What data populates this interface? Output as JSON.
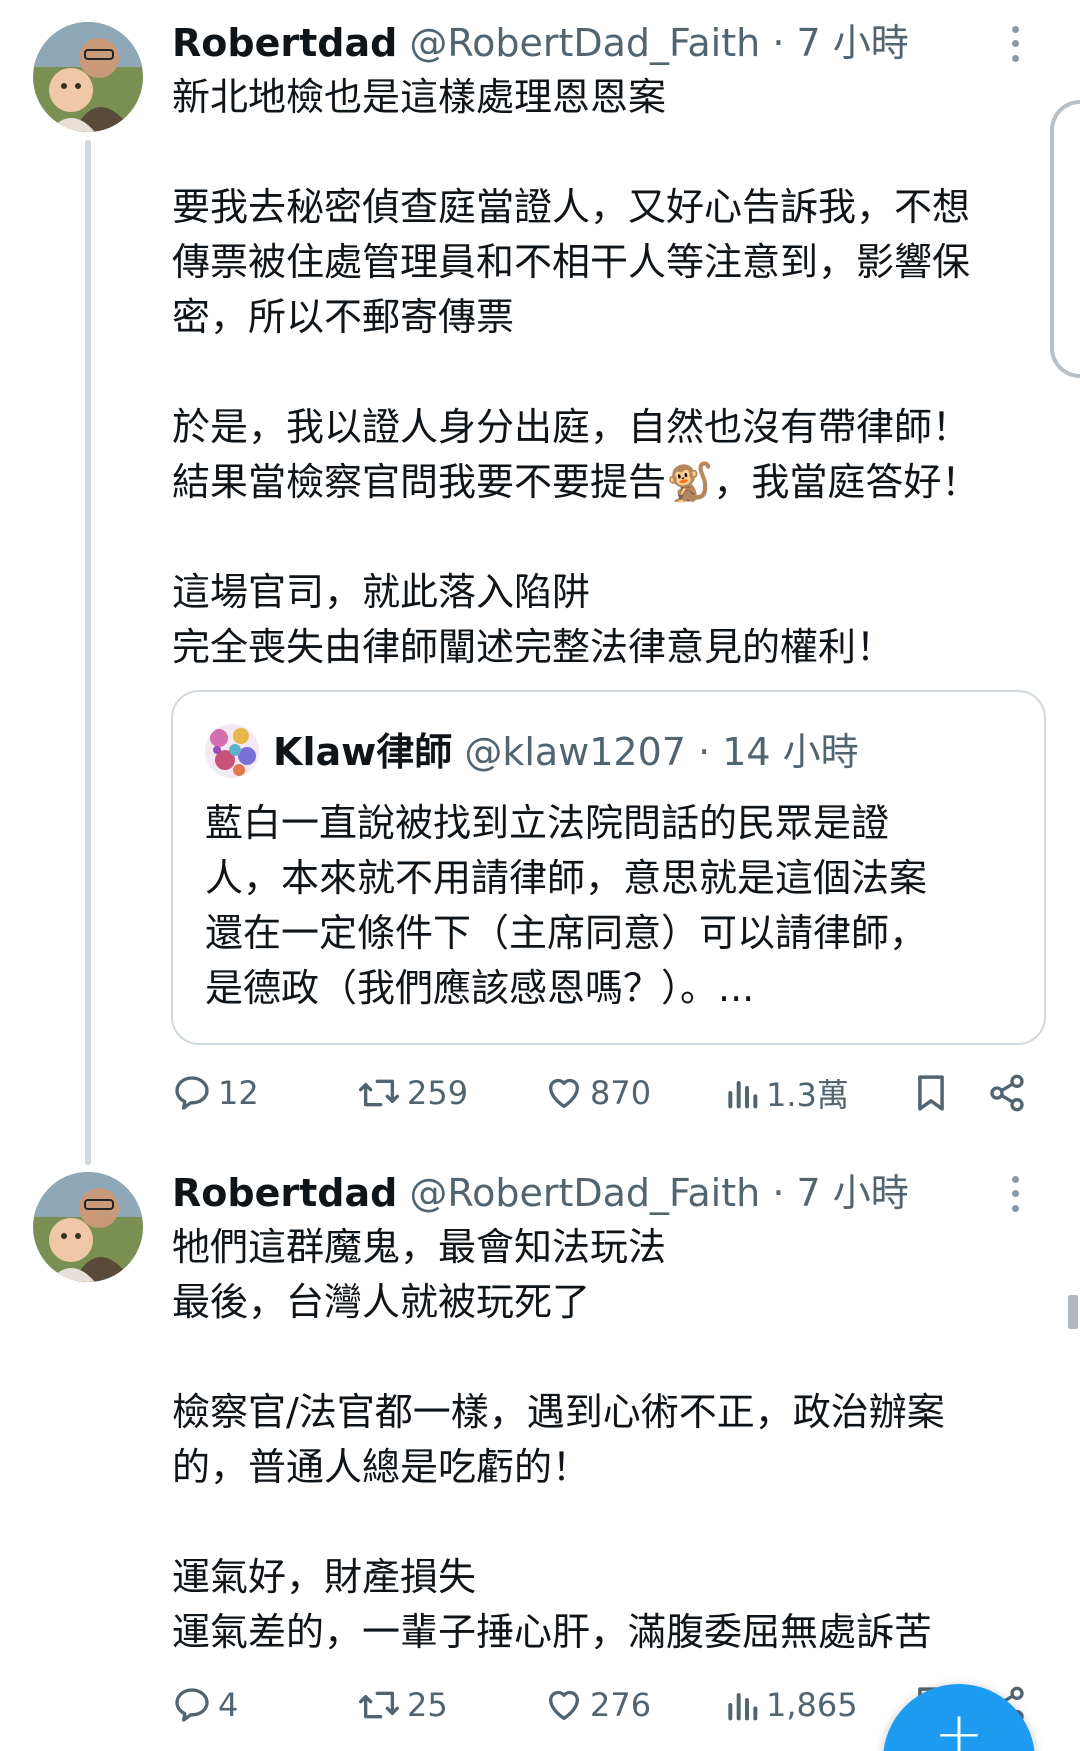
{
  "tweets": [
    {
      "name": "Robertdad",
      "handle": "@RobertDad_Faith",
      "dot": "·",
      "time": "7 小時",
      "paragraphs": [
        "新北地檢也是這樣處理恩恩案",
        "要我去秘密偵查庭當證人，又好心告訴我，不想\n傳票被住處管理員和不相干人等注意到，影響保\n密，所以不郵寄傳票",
        "於是，我以證人身分出庭，自然也沒有帶律師！\n結果當檢察官問我要不要提告🐒，我當庭答好！",
        "這場官司，就此落入陷阱\n完全喪失由律師闡述完整法律意見的權利！"
      ],
      "quote": {
        "name": "Klaw律師",
        "handle": "@klaw1207",
        "dot": "·",
        "time": "14 小時",
        "text": "藍白一直說被找到立法院問話的民眾是證\n人，本來就不用請律師，意思就是這個法案\n還在一定條件下（主席同意）可以請律師，\n是德政（我們應該感恩嗎？）。..."
      },
      "stats": {
        "replies": "12",
        "retweets": "259",
        "likes": "870",
        "views": "1.3萬"
      }
    },
    {
      "name": "Robertdad",
      "handle": "@RobertDad_Faith",
      "dot": "·",
      "time": "7 小時",
      "paragraphs": [
        "牠們這群魔鬼，最會知法玩法\n最後，台灣人就被玩死了",
        "檢察官/法官都一樣，遇到心術不正，政治辦案\n的，普通人總是吃虧的！",
        "運氣好，財產損失\n運氣差的，一輩子捶心肝，滿腹委屈無處訴苦"
      ],
      "stats": {
        "replies": "4",
        "retweets": "25",
        "likes": "276",
        "views": "1,865"
      }
    }
  ],
  "fab": {
    "label": "+"
  },
  "colors": {
    "accent": "#1d9bf0",
    "muted": "#536471",
    "border": "#cfd9de"
  }
}
